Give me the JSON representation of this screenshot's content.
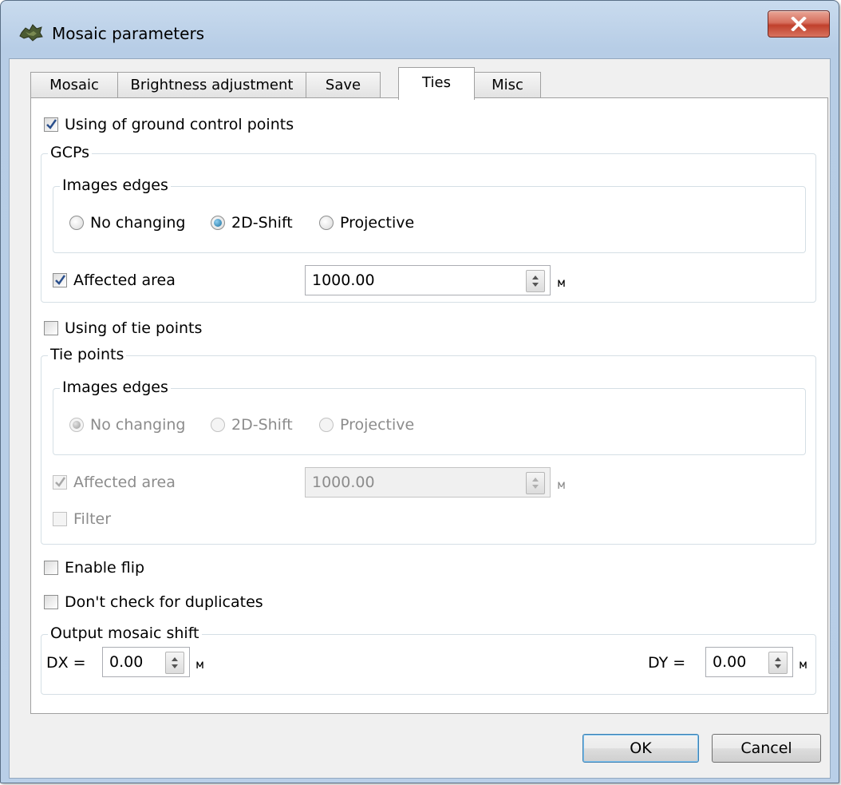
{
  "window": {
    "title": "Mosaic parameters"
  },
  "tabs": [
    {
      "label": "Mosaic"
    },
    {
      "label": "Brightness adjustment"
    },
    {
      "label": "Save"
    },
    {
      "label": "Ties",
      "active": true
    },
    {
      "label": "Misc"
    }
  ],
  "ties": {
    "gcp_checkbox": {
      "label": "Using of ground control points",
      "checked": true
    },
    "gcps_group": {
      "title": "GCPs",
      "edges_title": "Images edges",
      "options": [
        "No changing",
        "2D-Shift",
        "Projective"
      ],
      "selected": "2D-Shift",
      "affected_area": {
        "label": "Affected area",
        "checked": true,
        "value": "1000.00",
        "unit": "м"
      }
    },
    "tie_checkbox": {
      "label": "Using of tie points",
      "checked": false
    },
    "tie_group": {
      "title": "Tie points",
      "edges_title": "Images edges",
      "options": [
        "No changing",
        "2D-Shift",
        "Projective"
      ],
      "selected": "No changing",
      "affected_area": {
        "label": "Affected area",
        "checked": true,
        "value": "1000.00",
        "unit": "м"
      },
      "filter": {
        "label": "Filter",
        "checked": false
      },
      "enabled": false
    },
    "enable_flip": {
      "label": "Enable flip",
      "checked": false
    },
    "no_duplicates": {
      "label": "Don't check for duplicates",
      "checked": false
    },
    "shift_group": {
      "title": "Output mosaic shift",
      "dx_label": "DX =",
      "dx_value": "0.00",
      "dy_label": "DY =",
      "dy_value": "0.00",
      "unit": "м"
    }
  },
  "buttons": {
    "ok": "OK",
    "cancel": "Cancel"
  },
  "icons": {
    "app": "mosaic-app-icon",
    "close": "close-icon"
  },
  "colors": {
    "accent": "#1b6e9c",
    "close": "#c0402c"
  }
}
